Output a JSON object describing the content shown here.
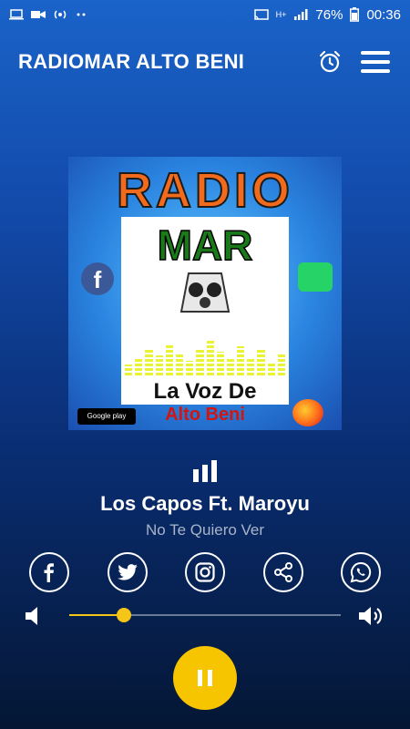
{
  "status_bar": {
    "battery": "76%",
    "time": "00:36",
    "network": "H+"
  },
  "app": {
    "title": "RADIOMAR ALTO BENI"
  },
  "cover": {
    "line1": "RADIO",
    "line2": "MAR",
    "slogan1": "La Voz De",
    "slogan2": "Alto Beni",
    "store_badge": "Google play"
  },
  "now_playing": {
    "title": "Los Capos Ft. Maroyu",
    "subtitle": "No Te Quiero Ver"
  },
  "socials": [
    "facebook",
    "twitter",
    "instagram",
    "share",
    "whatsapp"
  ],
  "volume": {
    "level": 0.2
  },
  "colors": {
    "accent": "#f7c400",
    "bg_top": "#1a63c9",
    "bg_bottom": "#041634"
  }
}
